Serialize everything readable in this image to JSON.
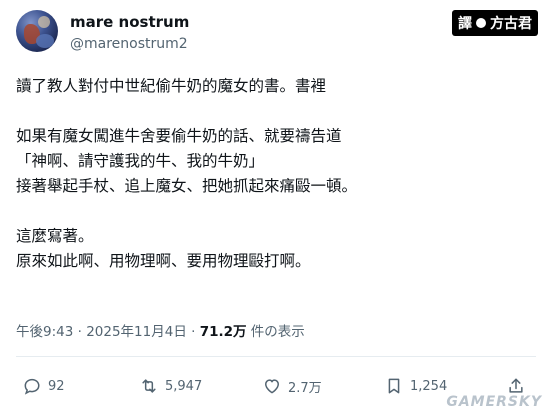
{
  "author": {
    "display_name": "mare nostrum",
    "handle": "@marenostrum2"
  },
  "translator_badge": {
    "prefix": "譯",
    "name": "方古君"
  },
  "tweet": {
    "lines": [
      "讀了教人對付中世紀偷牛奶的魔女的書。書裡",
      "",
      "如果有魔女闖進牛舍要偷牛奶的話、就要禱告道",
      "「神啊、請守護我的牛、我的牛奶」",
      "接著舉起手杖、追上魔女、把她抓起來痛毆一頓。",
      "",
      "這麼寫著。",
      "原來如此啊、用物理啊、要用物理毆打啊。"
    ]
  },
  "meta": {
    "time": "午後9:43",
    "dot": " · ",
    "date": "2025年11月4日",
    "dot2": " · ",
    "views": "71.2万",
    "views_suffix": " 件の表示"
  },
  "actions": {
    "reply_count": "92",
    "retweet_count": "5,947",
    "like_count": "2.7万",
    "bookmark_count": "1,254"
  },
  "icons": {
    "reply": "reply-icon",
    "retweet": "retweet-icon",
    "like": "heart-icon",
    "bookmark": "bookmark-icon",
    "share": "share-icon"
  },
  "colors": {
    "text": "#0f1419",
    "secondary": "#536471",
    "badge_bg": "#000000"
  },
  "watermark": "GAMERSKY"
}
